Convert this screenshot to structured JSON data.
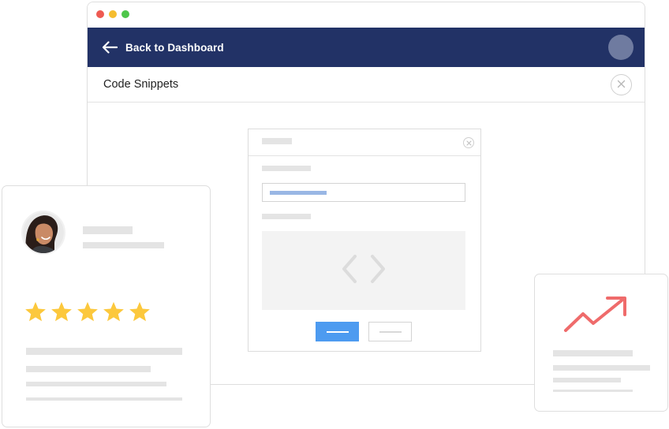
{
  "window": {
    "controls": [
      "close",
      "minimize",
      "maximize"
    ],
    "nav": {
      "back_label": "Back to Dashboard",
      "back_icon": "arrow-left-icon",
      "avatar": "user-avatar"
    },
    "subheader": {
      "title": "Code Snippets",
      "close_icon": "close-icon"
    },
    "dialog": {
      "close_icon": "close-icon",
      "code_icon": "code-brackets-icon"
    }
  },
  "review_card": {
    "rating": 5,
    "max_rating": 5,
    "star_color": "#fcc83d"
  },
  "growth_card": {
    "trend_icon": "trending-up-icon",
    "trend_color": "#ef6b6b"
  },
  "colors": {
    "nav_bg": "#223266",
    "primary_button": "#4d9bf0"
  }
}
